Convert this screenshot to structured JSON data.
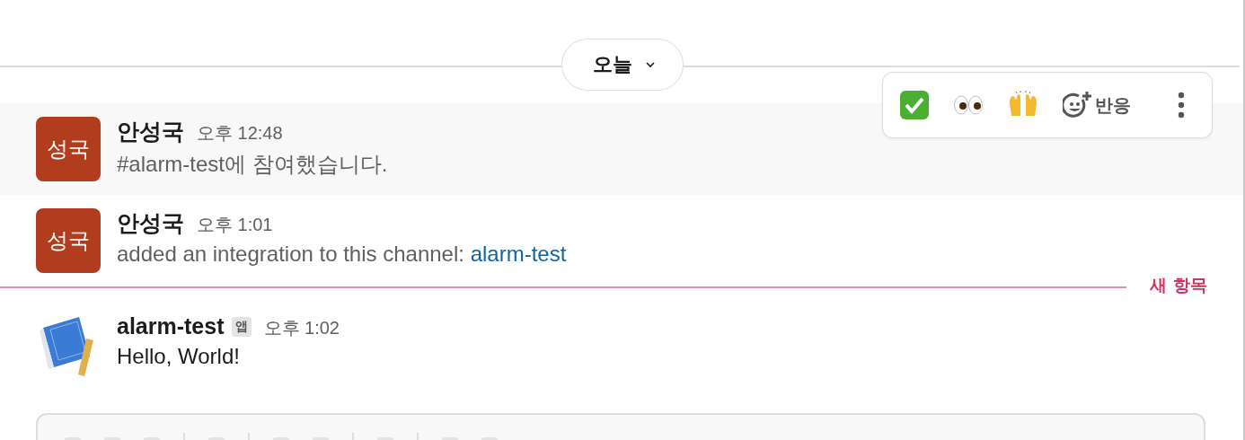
{
  "date_divider": {
    "label": "오늘"
  },
  "actions": {
    "reaction_label": "반응"
  },
  "messages": [
    {
      "kind": "user",
      "avatar_text": "성국",
      "author": "안성국",
      "time": "오후 12:48",
      "text": "#alarm-test에 참여했습니다.",
      "hovered": true
    },
    {
      "kind": "user",
      "avatar_text": "성국",
      "author": "안성국",
      "time": "오후 1:01",
      "text": "added an integration to this channel:",
      "link": "alarm-test",
      "hovered": false
    },
    {
      "kind": "divider",
      "label": "새 항목"
    },
    {
      "kind": "app",
      "author": "alarm-test",
      "badge": "앱",
      "time": "오후 1:02",
      "text": "Hello, World!",
      "hovered": false
    }
  ]
}
